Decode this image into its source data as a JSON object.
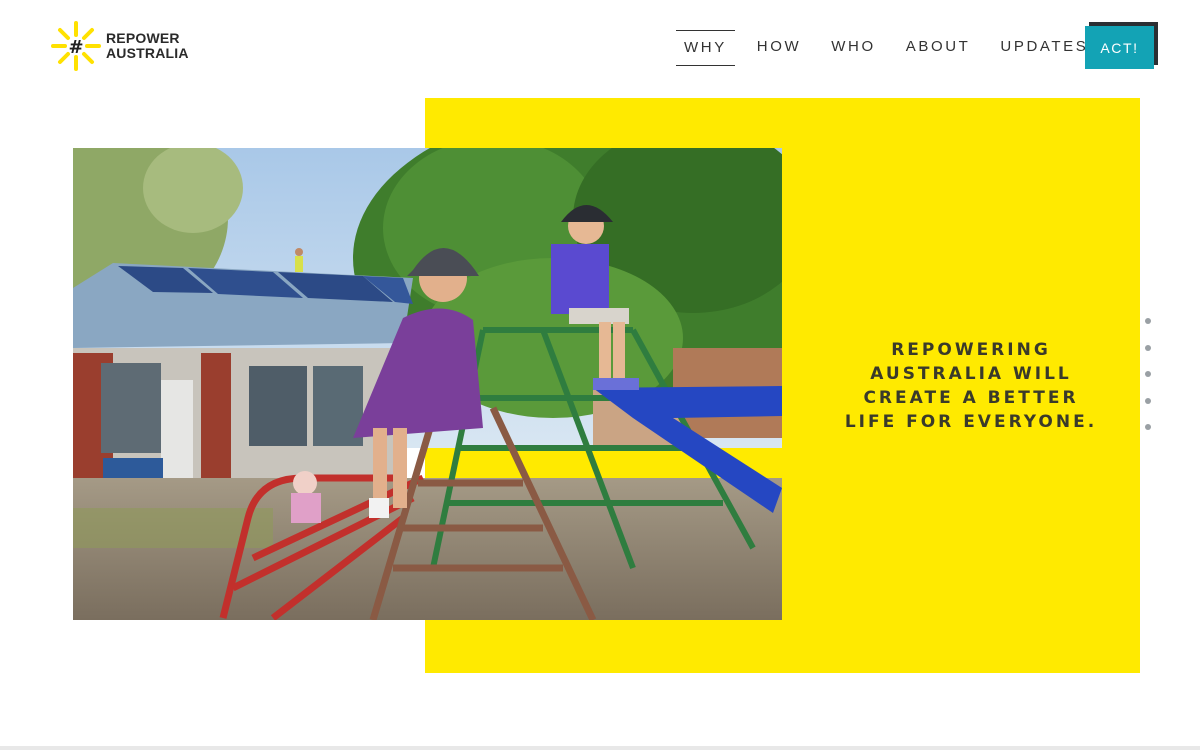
{
  "brand": {
    "line1": "REPOWER",
    "line2": "AUSTRALIA",
    "logo_icon": "sun-hash-icon",
    "accent_color": "#ffea00"
  },
  "nav": {
    "items": [
      {
        "label": "WHY",
        "active": true
      },
      {
        "label": "HOW",
        "active": false
      },
      {
        "label": "WHO",
        "active": false
      },
      {
        "label": "ABOUT",
        "active": false
      },
      {
        "label": "UPDATES",
        "active": false
      }
    ],
    "cta_label": "ACT!",
    "cta_color": "#13a3b5"
  },
  "hero": {
    "headline_lines": [
      "REPOWERING",
      "AUSTRALIA WILL",
      "CREATE A BETTER",
      "LIFE FOR EVERYONE."
    ],
    "panel_color": "#ffea00",
    "slide_count": 5
  }
}
